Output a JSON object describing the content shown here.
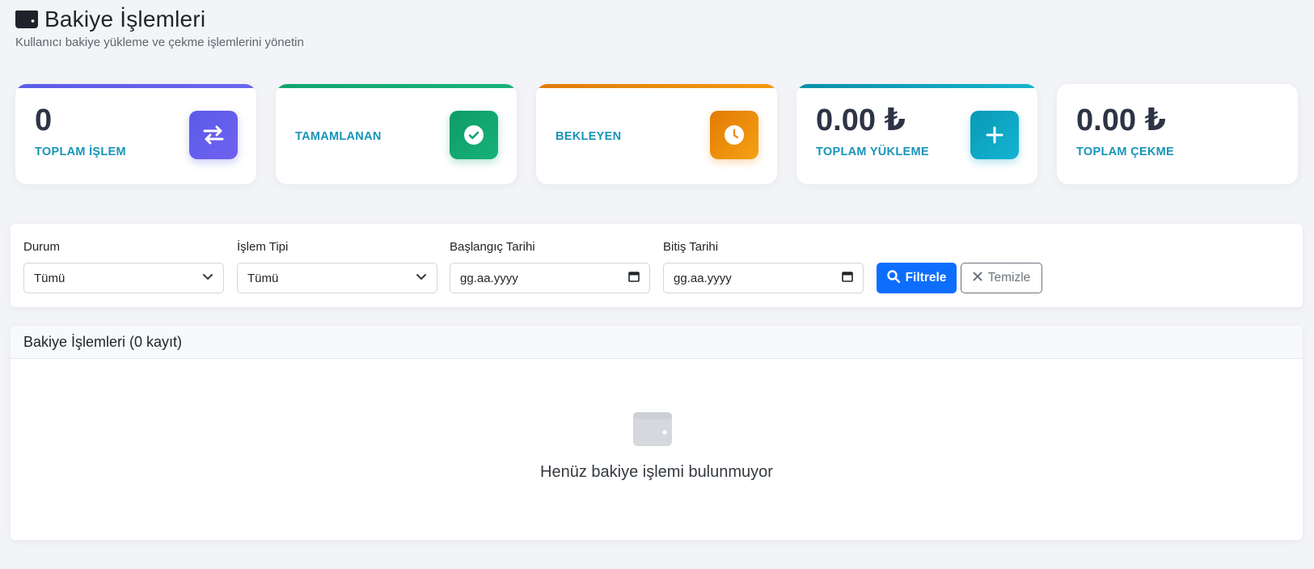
{
  "header": {
    "icon": "wallet-icon",
    "title": "Bakiye İşlemleri",
    "subtitle": "Kullanıcı bakiye yükleme ve çekme işlemlerini yönetin"
  },
  "stats": [
    {
      "value": "0",
      "label": "TOPLAM İŞLEM",
      "icon": "arrows-exchange-icon",
      "accent": "#5b5be8"
    },
    {
      "value": "",
      "label": "TAMAMLANAN",
      "icon": "check-circle-icon",
      "accent": "#10a66e"
    },
    {
      "value": "",
      "label": "BEKLEYEN",
      "icon": "clock-icon",
      "accent": "#ef8a0c"
    },
    {
      "value": "0.00 ₺",
      "label": "TOPLAM YÜKLEME",
      "icon": "plus-icon",
      "accent": "#0aa7c7"
    },
    {
      "value": "0.00 ₺",
      "label": "TOPLAM ÇEKME",
      "icon": "",
      "accent": "#ffffff"
    }
  ],
  "filters": {
    "status_label": "Durum",
    "status_value": "Tümü",
    "type_label": "İşlem Tipi",
    "type_value": "Tümü",
    "start_label": "Başlangıç Tarihi",
    "start_placeholder": "gg.aa.yyyy",
    "end_label": "Bitiş Tarihi",
    "end_placeholder": "gg.aa.yyyy",
    "filter_button": "Filtrele",
    "clear_button": "Temizle"
  },
  "list": {
    "title": "Bakiye İşlemleri (0 kayıt)",
    "empty_text": "Henüz bakiye işlemi bulunmuyor"
  },
  "colors": {
    "primary": "#0d6efd",
    "label": "#1794b8",
    "value": "#2c3445"
  }
}
